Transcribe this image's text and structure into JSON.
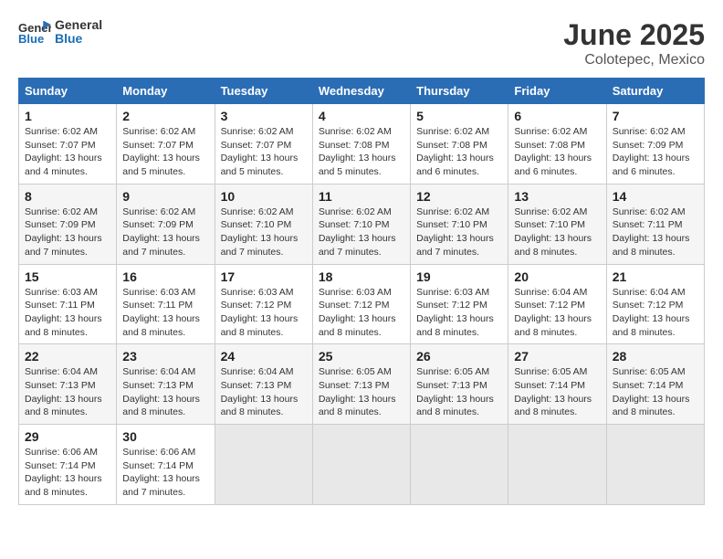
{
  "header": {
    "logo_general": "General",
    "logo_blue": "Blue",
    "month": "June 2025",
    "location": "Colotepec, Mexico"
  },
  "days_of_week": [
    "Sunday",
    "Monday",
    "Tuesday",
    "Wednesday",
    "Thursday",
    "Friday",
    "Saturday"
  ],
  "weeks": [
    [
      {
        "day": "1",
        "sunrise": "6:02 AM",
        "sunset": "7:07 PM",
        "daylight": "13 hours and 4 minutes."
      },
      {
        "day": "2",
        "sunrise": "6:02 AM",
        "sunset": "7:07 PM",
        "daylight": "13 hours and 5 minutes."
      },
      {
        "day": "3",
        "sunrise": "6:02 AM",
        "sunset": "7:07 PM",
        "daylight": "13 hours and 5 minutes."
      },
      {
        "day": "4",
        "sunrise": "6:02 AM",
        "sunset": "7:08 PM",
        "daylight": "13 hours and 5 minutes."
      },
      {
        "day": "5",
        "sunrise": "6:02 AM",
        "sunset": "7:08 PM",
        "daylight": "13 hours and 6 minutes."
      },
      {
        "day": "6",
        "sunrise": "6:02 AM",
        "sunset": "7:08 PM",
        "daylight": "13 hours and 6 minutes."
      },
      {
        "day": "7",
        "sunrise": "6:02 AM",
        "sunset": "7:09 PM",
        "daylight": "13 hours and 6 minutes."
      }
    ],
    [
      {
        "day": "8",
        "sunrise": "6:02 AM",
        "sunset": "7:09 PM",
        "daylight": "13 hours and 7 minutes."
      },
      {
        "day": "9",
        "sunrise": "6:02 AM",
        "sunset": "7:09 PM",
        "daylight": "13 hours and 7 minutes."
      },
      {
        "day": "10",
        "sunrise": "6:02 AM",
        "sunset": "7:10 PM",
        "daylight": "13 hours and 7 minutes."
      },
      {
        "day": "11",
        "sunrise": "6:02 AM",
        "sunset": "7:10 PM",
        "daylight": "13 hours and 7 minutes."
      },
      {
        "day": "12",
        "sunrise": "6:02 AM",
        "sunset": "7:10 PM",
        "daylight": "13 hours and 7 minutes."
      },
      {
        "day": "13",
        "sunrise": "6:02 AM",
        "sunset": "7:10 PM",
        "daylight": "13 hours and 8 minutes."
      },
      {
        "day": "14",
        "sunrise": "6:02 AM",
        "sunset": "7:11 PM",
        "daylight": "13 hours and 8 minutes."
      }
    ],
    [
      {
        "day": "15",
        "sunrise": "6:03 AM",
        "sunset": "7:11 PM",
        "daylight": "13 hours and 8 minutes."
      },
      {
        "day": "16",
        "sunrise": "6:03 AM",
        "sunset": "7:11 PM",
        "daylight": "13 hours and 8 minutes."
      },
      {
        "day": "17",
        "sunrise": "6:03 AM",
        "sunset": "7:12 PM",
        "daylight": "13 hours and 8 minutes."
      },
      {
        "day": "18",
        "sunrise": "6:03 AM",
        "sunset": "7:12 PM",
        "daylight": "13 hours and 8 minutes."
      },
      {
        "day": "19",
        "sunrise": "6:03 AM",
        "sunset": "7:12 PM",
        "daylight": "13 hours and 8 minutes."
      },
      {
        "day": "20",
        "sunrise": "6:04 AM",
        "sunset": "7:12 PM",
        "daylight": "13 hours and 8 minutes."
      },
      {
        "day": "21",
        "sunrise": "6:04 AM",
        "sunset": "7:12 PM",
        "daylight": "13 hours and 8 minutes."
      }
    ],
    [
      {
        "day": "22",
        "sunrise": "6:04 AM",
        "sunset": "7:13 PM",
        "daylight": "13 hours and 8 minutes."
      },
      {
        "day": "23",
        "sunrise": "6:04 AM",
        "sunset": "7:13 PM",
        "daylight": "13 hours and 8 minutes."
      },
      {
        "day": "24",
        "sunrise": "6:04 AM",
        "sunset": "7:13 PM",
        "daylight": "13 hours and 8 minutes."
      },
      {
        "day": "25",
        "sunrise": "6:05 AM",
        "sunset": "7:13 PM",
        "daylight": "13 hours and 8 minutes."
      },
      {
        "day": "26",
        "sunrise": "6:05 AM",
        "sunset": "7:13 PM",
        "daylight": "13 hours and 8 minutes."
      },
      {
        "day": "27",
        "sunrise": "6:05 AM",
        "sunset": "7:14 PM",
        "daylight": "13 hours and 8 minutes."
      },
      {
        "day": "28",
        "sunrise": "6:05 AM",
        "sunset": "7:14 PM",
        "daylight": "13 hours and 8 minutes."
      }
    ],
    [
      {
        "day": "29",
        "sunrise": "6:06 AM",
        "sunset": "7:14 PM",
        "daylight": "13 hours and 8 minutes."
      },
      {
        "day": "30",
        "sunrise": "6:06 AM",
        "sunset": "7:14 PM",
        "daylight": "13 hours and 7 minutes."
      },
      null,
      null,
      null,
      null,
      null
    ]
  ]
}
